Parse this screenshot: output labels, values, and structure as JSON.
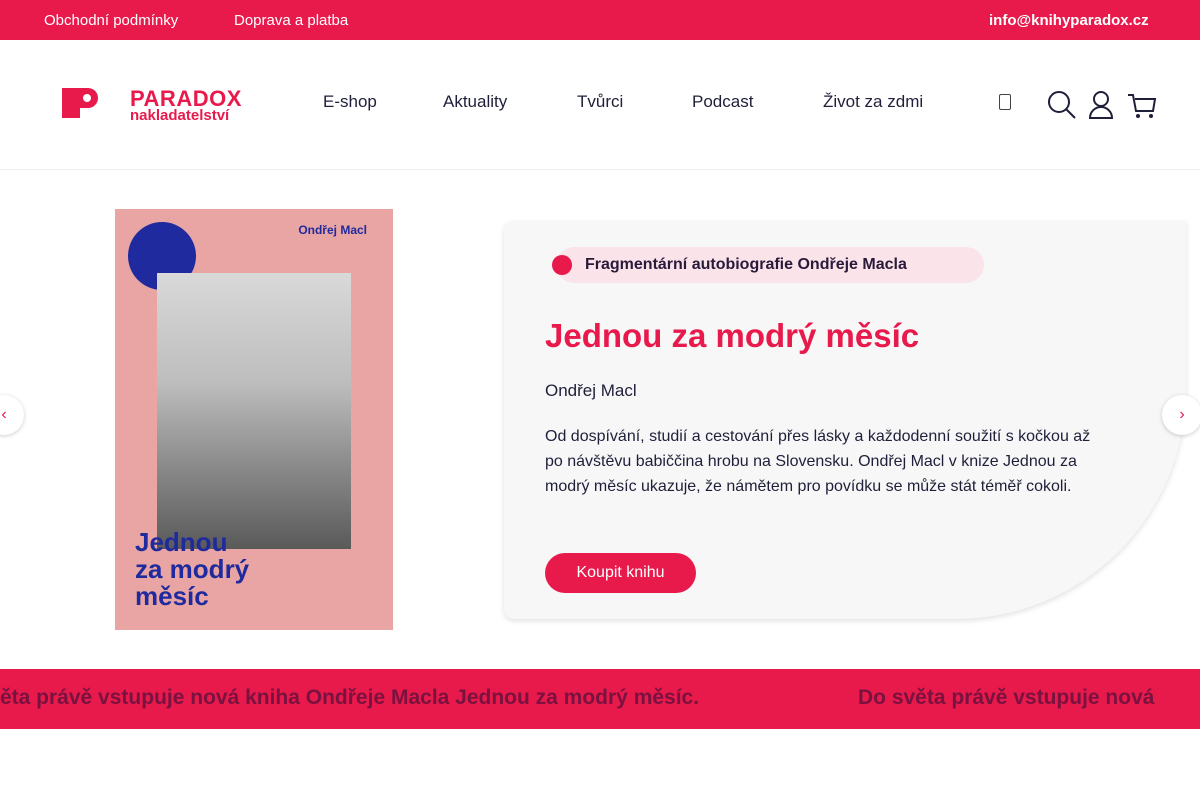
{
  "topbar": {
    "links": [
      "Obchodní podmínky",
      "Doprava a platba"
    ],
    "email": "info@knihyparadox.cz"
  },
  "logo": {
    "name": "PARADOX",
    "subtitle": "nakladatelství"
  },
  "nav": {
    "items": [
      "E-shop",
      "Aktuality",
      "Tvůrci",
      "Podcast",
      "Život za zdmi"
    ]
  },
  "header_icons": [
    "menu-icon",
    "search-icon",
    "user-icon",
    "cart-icon"
  ],
  "hero": {
    "cover": {
      "author": "Ondřej Macl",
      "title": "Jednou\nza modrý\nměsíc"
    },
    "tag": "Fragmentární autobiografie Ondřeje Macla",
    "title": "Jednou za modrý měsíc",
    "author": "Ondřej Macl",
    "description": "Od dospívání, studií a cestování přes lásky a každodenní soužití s kočkou až po návštěvu babiččina hrobu na Slovensku. Ondřej Macl v knize Jednou za modrý měsíc ukazuje, že námětem pro povídku se může stát téměř cokoli.",
    "button": "Koupit knihu"
  },
  "marquee": {
    "part1": "ěta právě vstupuje nová kniha Ondřeje Macla Jednou za modrý měsíc.",
    "part2": "Do světa právě vstupuje nová"
  },
  "colors": {
    "brand": "#e8194b",
    "dark": "#1f1f3a",
    "cover_blue": "#1f2a9e"
  }
}
